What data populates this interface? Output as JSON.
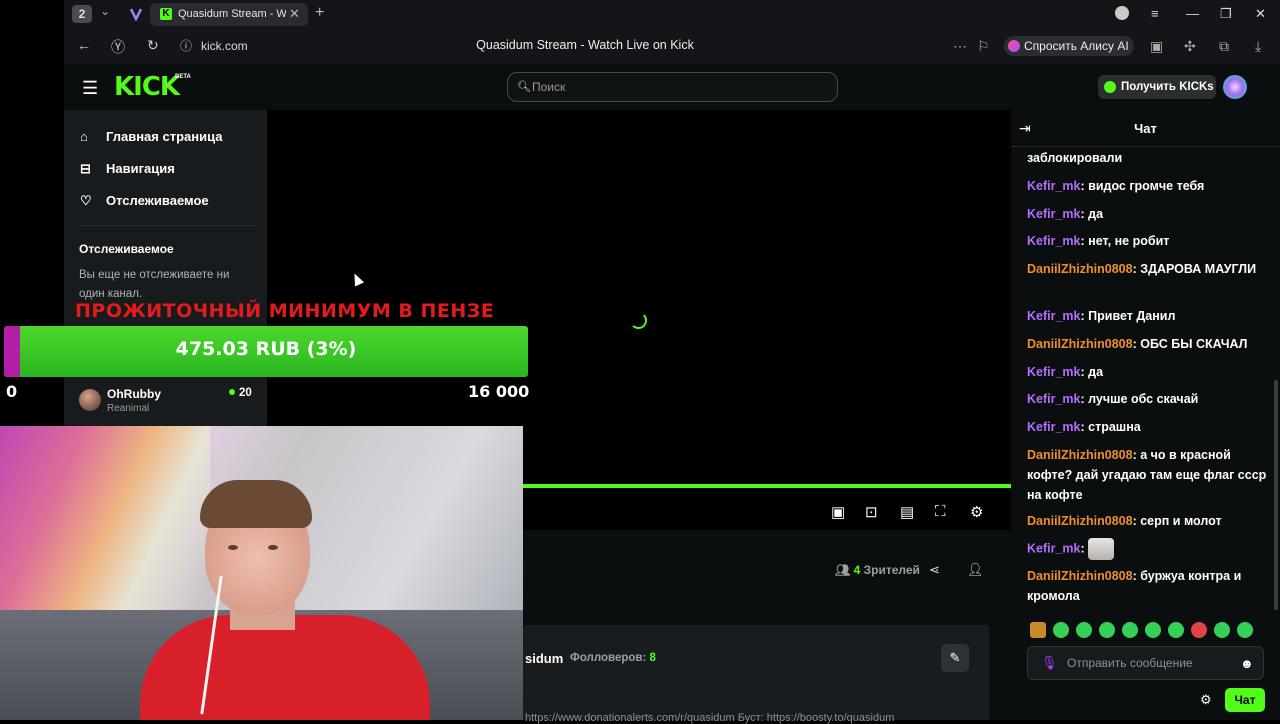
{
  "browser": {
    "tab_count": "2",
    "tab_title": "Quasidum Stream - Wa",
    "url": "kick.com",
    "page_title": "Quasidum Stream - Watch Live on Kick",
    "alisa_label": "Спросить Алису AI"
  },
  "header": {
    "logo": "KICK",
    "beta": "BETA",
    "search_placeholder": "Поиск",
    "get_kicks": "Получить KICKs"
  },
  "sidebar": {
    "items": [
      {
        "label": "Главная страница",
        "icon": "home-icon"
      },
      {
        "label": "Навигация",
        "icon": "compass-icon"
      },
      {
        "label": "Отслеживаемое",
        "icon": "heart-icon"
      }
    ],
    "following_heading": "Отслеживаемое",
    "following_note": "Вы еще не отслеживаете ни один канал.",
    "recommended": {
      "name": "OhRubby",
      "category": "Reanimal",
      "viewers": "20"
    }
  },
  "goal": {
    "title": "ПРОЖИТОЧНЫЙ МИНИМУМ В ПЕНЗЕ",
    "amount": "475.03 RUB (3%)",
    "progress_percent": 3,
    "min": "0",
    "max": "16 000"
  },
  "stream": {
    "viewers_count": "4",
    "viewers_label": "Зрителей",
    "channel": "sidum",
    "followers_label": "Фолловеров:",
    "followers_count": "8",
    "bio": "https://www.donationalerts.com/r/quasidum Буст: https://boosty.to/quasidum"
  },
  "chat": {
    "title": "Чат",
    "messages": [
      {
        "user": "",
        "text": "заблокировали"
      },
      {
        "user": "Kefir_mk",
        "text": "видос громче тебя"
      },
      {
        "user": "Kefir_mk",
        "text": "да"
      },
      {
        "user": "Kefir_mk",
        "text": "нет, не робит"
      },
      {
        "user": "DaniilZhizhin0808",
        "text": "ЗДАРОВА МАУГЛИ"
      },
      {
        "user": "Kefir_mk",
        "text": "Привет Данил"
      },
      {
        "user": "DaniilZhizhin0808",
        "text": "ОБС БЫ СКАЧАЛ"
      },
      {
        "user": "Kefir_mk",
        "text": "да"
      },
      {
        "user": "Kefir_mk",
        "text": "лучше обс скачай"
      },
      {
        "user": "Kefir_mk",
        "text": "страшна"
      },
      {
        "user": "DaniilZhizhin0808",
        "text": "а чо в красной кофте? дай угадаю там еще флаг ссср на кофте"
      },
      {
        "user": "DaniilZhizhin0808",
        "text": "серп и молот"
      },
      {
        "user": "Kefir_mk",
        "text": ""
      },
      {
        "user": "DaniilZhizhin0808",
        "text": "буржуа контра и кромола"
      }
    ],
    "input_placeholder": "Отправить сообщение",
    "send_label": "Чат",
    "colors": {
      "kefir": "#b56cff",
      "daniil": "#f08f2b",
      "accent": "#53fc18"
    }
  }
}
